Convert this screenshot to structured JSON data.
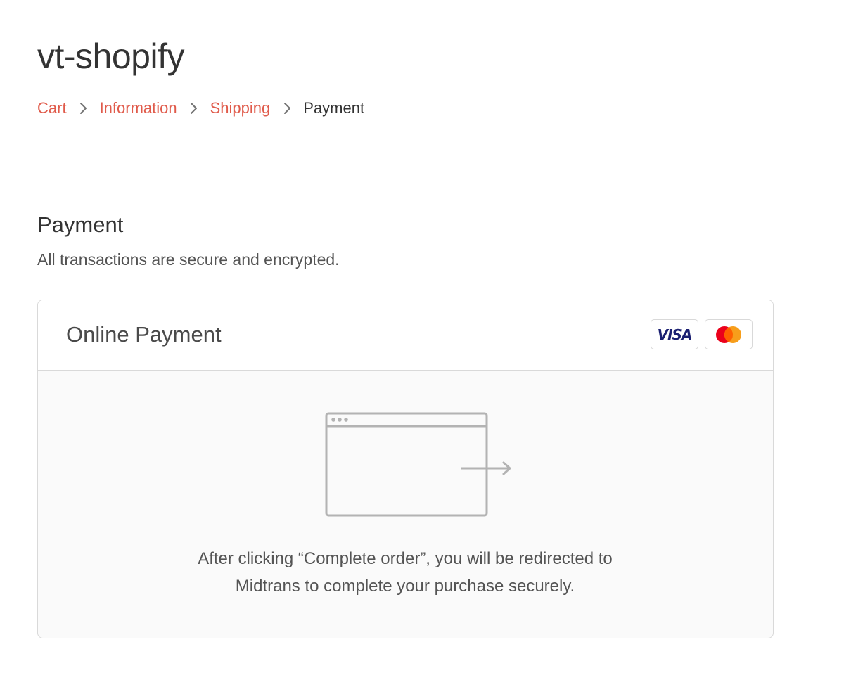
{
  "store": {
    "name": "vt-shopify"
  },
  "breadcrumb": {
    "steps": [
      {
        "label": "Cart",
        "state": "completed"
      },
      {
        "label": "Information",
        "state": "completed"
      },
      {
        "label": "Shipping",
        "state": "completed"
      },
      {
        "label": "Payment",
        "state": "current"
      }
    ],
    "separator_icon": "chevron-right-icon"
  },
  "payment": {
    "title": "Payment",
    "subtitle": "All transactions are secure and encrypted.",
    "method": {
      "label": "Online Payment",
      "card_brands": [
        {
          "name": "VISA",
          "icon": "visa-logo-icon"
        },
        {
          "name": "Mastercard",
          "icon": "mastercard-logo-icon"
        }
      ]
    },
    "redirect": {
      "illustration_icon": "browser-redirect-icon",
      "line1": "After clicking “Complete order”, you will be redirected to",
      "line2": "Midtrans to complete your purchase securely."
    }
  },
  "colors": {
    "accent": "#e05b4b",
    "text": "#333333",
    "muted_text": "#545454",
    "border": "#d9d9d9",
    "panel_bg": "#fafafa",
    "visa_blue": "#1a1f71",
    "mc_red": "#eb001b",
    "mc_orange": "#f79e1b"
  }
}
